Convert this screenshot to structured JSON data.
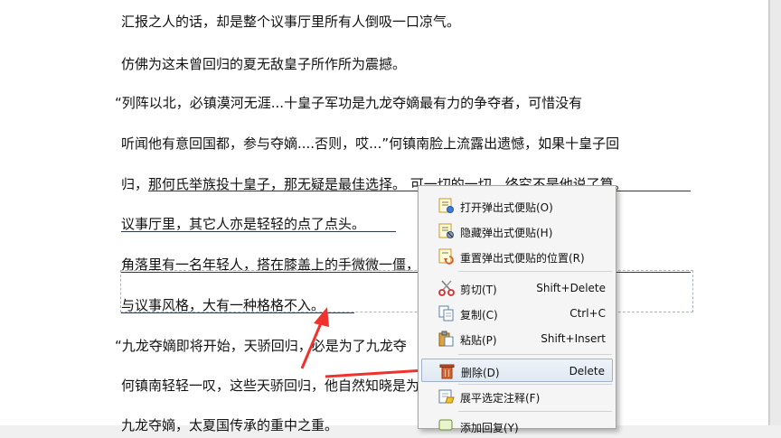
{
  "document": {
    "lines": [
      "汇报之人的话，却是整个议事厅里所有人倒吸一口凉气。",
      "仿佛为这未曾回归的夏无敌皇子所作所为震撼。",
      "“列阵以北，必镇漠河无涯...十皇子军功是九龙夺嫡最有力的争夺者，可惜没有",
      "听闻他有意回国都，参与夺嫡....否则，哎...”何镇南脸上流露出遗憾，如果十皇子回",
      "归，那何氏举族投十皇子，那无疑是最佳选择。        可一切的一切，终究不是他说了算。",
      "议事厅里，其它人亦是轻轻的点了点头。",
      "角落里有一名年轻人，搭在膝盖上的手微微一僵，                                                                    群立。",
      "与议事风格，大有一种格格不入。",
      "“九龙夺嫡即将开始，天骄回归，必是为了九龙夺",
      "何镇南轻轻一叹，这些天骄回归，他自然知晓是为",
      "九龙夺嫡，太夏国传承的重中之重。"
    ]
  },
  "context_menu": {
    "items": [
      {
        "label": "打开弹出式便贴(O)",
        "shortcut": "",
        "icon": "note-open-icon"
      },
      {
        "label": "隐藏弹出式便贴(H)",
        "shortcut": "",
        "icon": "note-hide-icon"
      },
      {
        "label": "重置弹出式便贴的位置(R)",
        "shortcut": "",
        "icon": "note-reset-icon"
      },
      {
        "label": "剪切(T)",
        "shortcut": "Shift+Delete",
        "icon": "scissors-icon"
      },
      {
        "label": "复制(C)",
        "shortcut": "Ctrl+C",
        "icon": "copy-icon"
      },
      {
        "label": "粘贴(P)",
        "shortcut": "Shift+Insert",
        "icon": "paste-icon"
      },
      {
        "label": "删除(D)",
        "shortcut": "Delete",
        "icon": "trash-icon"
      },
      {
        "label": "展平选定注释(F)",
        "shortcut": "",
        "icon": "flatten-icon"
      },
      {
        "label": "添加回复(Y)",
        "shortcut": "",
        "icon": "reply-icon"
      }
    ],
    "highlighted": "删除(D)"
  },
  "colors": {
    "arrow": "#f0312c",
    "underline": "#2d3b4d",
    "highlight_border": "#9fb4cc"
  }
}
